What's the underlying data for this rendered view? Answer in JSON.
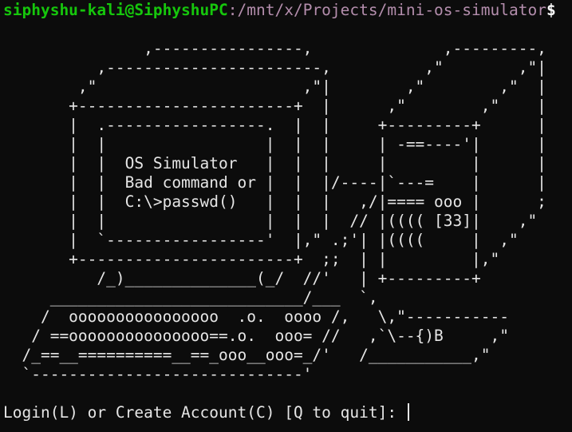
{
  "prompt": {
    "user_host": "siphyshu-kali@SiphyshuPC",
    "separator": ":",
    "path": "/mnt/x/Projects/mini-os-simulator",
    "symbol": "$"
  },
  "ascii_art": "               ,----------------,              ,---------,\n          ,-----------------------,          ,\"        ,\"|\n        ,\"                      ,\"|        ,\"        ,\"  |\n       +-----------------------+  |      ,\"        ,\"    |\n       |  .-----------------.  |  |     +---------+      |\n       |  |                 |  |  |     | -==----'|      |\n       |  |  OS Simulator   |  |  |     |         |      |\n       |  |  Bad command or |  |  |/----|`---=    |      |\n       |  |  C:\\>passwd()   |  |  |   ,/|==== ooo |      ;\n       |  |                 |  |  |  // |(((( [33]|    ,\"\n       |  `-----------------'  |,\" .;'| |((((     |  ,\"\n       +-----------------------+  ;;  | |         |,\"\n          /_)______________(_/  //'   | +---------+\n     ___________________________/___  `,\n    /  oooooooooooooooo  .o.  oooo /,   \\,\"-----------\n   / ==ooooooooooooooo==.o.  ooo= //   ,`\\--{)B     ,\"\n  /_==__==========__==_ooo__ooo=_/'   /___________,\"\n  `-----------------------------'",
  "login_prompt": "Login(L) or Create Account(C) [Q to quit]: "
}
